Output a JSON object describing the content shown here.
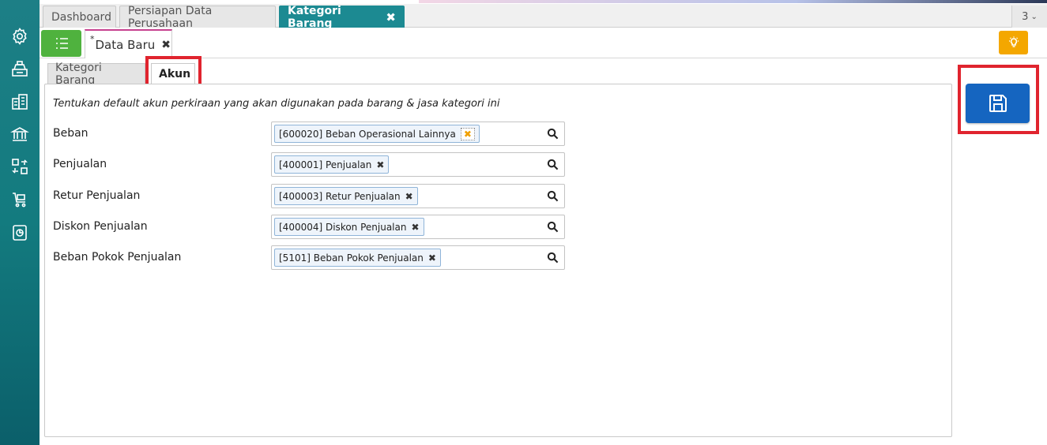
{
  "top_tabs": [
    {
      "label": "Dashboard"
    },
    {
      "label": "Persiapan Data Perusahaan"
    },
    {
      "label": "Kategori Barang",
      "close": "✖"
    }
  ],
  "tab_count": "3",
  "doc_tab": {
    "star": "*",
    "label": "Data Baru",
    "close": "✖"
  },
  "inner_tabs": [
    {
      "label": "Kategori Barang"
    },
    {
      "label": "Akun"
    }
  ],
  "description": "Tentukan default akun perkiraan yang akan digunakan pada barang & jasa kategori ini",
  "fields": [
    {
      "label": "Beban",
      "value": "[600020] Beban Operasional Lainnya",
      "remove": "✖"
    },
    {
      "label": "Penjualan",
      "value": "[400001] Penjualan",
      "remove": "✖"
    },
    {
      "label": "Retur Penjualan",
      "value": "[400003] Retur Penjualan",
      "remove": "✖"
    },
    {
      "label": "Diskon Penjualan",
      "value": "[400004] Diskon Penjualan",
      "remove": "✖"
    },
    {
      "label": "Beban Pokok Penjualan",
      "value": "[5101] Beban Pokok Penjualan",
      "remove": "✖"
    }
  ],
  "colors": {
    "sidebar": "#137b7f",
    "active_tab": "#1c8a92",
    "list_button": "#4fb23e",
    "bulb_button": "#f4a700",
    "save_button": "#1565c0",
    "highlight": "#e0242e"
  },
  "icons": {
    "sidebar": [
      "gear-icon",
      "cash-register-icon",
      "building-icon",
      "bank-icon",
      "transfer-icon",
      "cart-icon",
      "report-icon"
    ],
    "list": "list-icon",
    "bulb": "lightbulb-icon",
    "save": "floppy-disk-icon",
    "search": "search-icon"
  }
}
